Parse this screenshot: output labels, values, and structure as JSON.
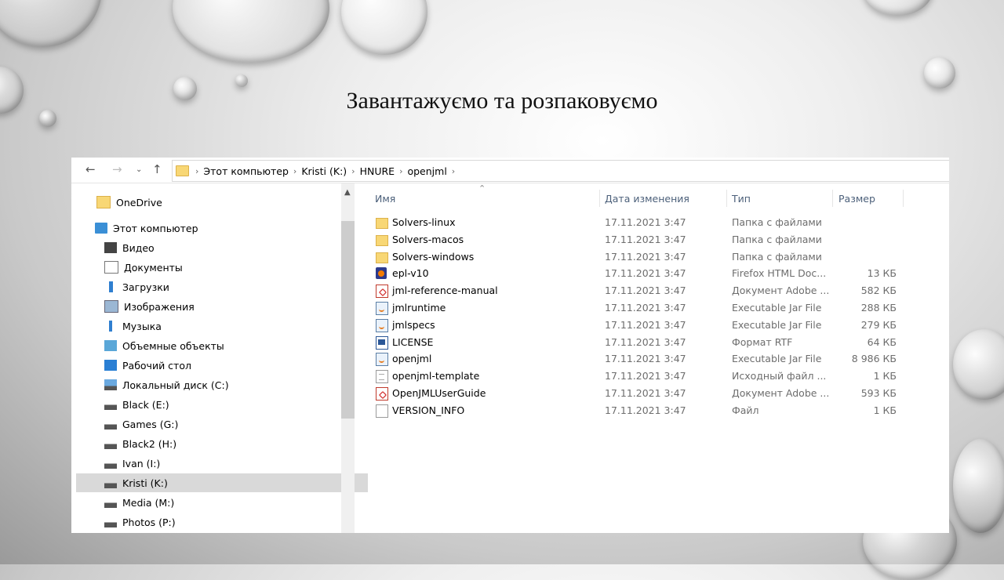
{
  "slide": {
    "title": "Завантажуємо та розпаковуємо"
  },
  "explorer": {
    "breadcrumb": [
      "Этот компьютер",
      "Kristi (K:)",
      "HNURE",
      "openjml"
    ],
    "columns": {
      "name": "Имя",
      "date": "Дата изменения",
      "type": "Тип",
      "size": "Размер"
    },
    "nav_items": [
      {
        "label": "OneDrive",
        "icon": "onedrive-folder-icon",
        "selected": false
      },
      {
        "label": "Этот компьютер",
        "icon": "computer-icon",
        "selected": false
      },
      {
        "label": "Видео",
        "icon": "video-icon",
        "selected": false
      },
      {
        "label": "Документы",
        "icon": "documents-icon",
        "selected": false
      },
      {
        "label": "Загрузки",
        "icon": "downloads-icon",
        "selected": false
      },
      {
        "label": "Изображения",
        "icon": "pictures-icon",
        "selected": false
      },
      {
        "label": "Музыка",
        "icon": "music-icon",
        "selected": false
      },
      {
        "label": "Объемные объекты",
        "icon": "3d-objects-icon",
        "selected": false
      },
      {
        "label": "Рабочий стол",
        "icon": "desktop-icon",
        "selected": false
      },
      {
        "label": "Локальный диск (C:)",
        "icon": "system-drive-icon",
        "selected": false
      },
      {
        "label": "Black (E:)",
        "icon": "drive-icon",
        "selected": false
      },
      {
        "label": "Games (G:)",
        "icon": "drive-icon",
        "selected": false
      },
      {
        "label": "Black2 (H:)",
        "icon": "drive-icon",
        "selected": false
      },
      {
        "label": "Ivan (I:)",
        "icon": "drive-icon",
        "selected": false
      },
      {
        "label": "Kristi (K:)",
        "icon": "drive-icon",
        "selected": true
      },
      {
        "label": "Media (M:)",
        "icon": "drive-icon",
        "selected": false
      },
      {
        "label": "Photos (P:)",
        "icon": "drive-icon",
        "selected": false
      }
    ],
    "files": [
      {
        "name": "Solvers-linux",
        "date": "17.11.2021 3:47",
        "type": "Папка с файлами",
        "size": "",
        "icon": "folder"
      },
      {
        "name": "Solvers-macos",
        "date": "17.11.2021 3:47",
        "type": "Папка с файлами",
        "size": "",
        "icon": "folder"
      },
      {
        "name": "Solvers-windows",
        "date": "17.11.2021 3:47",
        "type": "Папка с файлами",
        "size": "",
        "icon": "folder"
      },
      {
        "name": "epl-v10",
        "date": "17.11.2021 3:47",
        "type": "Firefox HTML Doc...",
        "size": "13 КБ",
        "icon": "html"
      },
      {
        "name": "jml-reference-manual",
        "date": "17.11.2021 3:47",
        "type": "Документ Adobe ...",
        "size": "582 КБ",
        "icon": "pdf"
      },
      {
        "name": "jmlruntime",
        "date": "17.11.2021 3:47",
        "type": "Executable Jar File",
        "size": "288 КБ",
        "icon": "jar"
      },
      {
        "name": "jmlspecs",
        "date": "17.11.2021 3:47",
        "type": "Executable Jar File",
        "size": "279 КБ",
        "icon": "jar"
      },
      {
        "name": "LICENSE",
        "date": "17.11.2021 3:47",
        "type": "Формат RTF",
        "size": "64 КБ",
        "icon": "rtf"
      },
      {
        "name": "openjml",
        "date": "17.11.2021 3:47",
        "type": "Executable Jar File",
        "size": "8 986 КБ",
        "icon": "jar"
      },
      {
        "name": "openjml-template",
        "date": "17.11.2021 3:47",
        "type": "Исходный файл ...",
        "size": "1 КБ",
        "icon": "txt"
      },
      {
        "name": "OpenJMLUserGuide",
        "date": "17.11.2021 3:47",
        "type": "Документ Adobe ...",
        "size": "593 КБ",
        "icon": "pdf"
      },
      {
        "name": "VERSION_INFO",
        "date": "17.11.2021 3:47",
        "type": "Файл",
        "size": "1 КБ",
        "icon": "blank"
      }
    ]
  }
}
